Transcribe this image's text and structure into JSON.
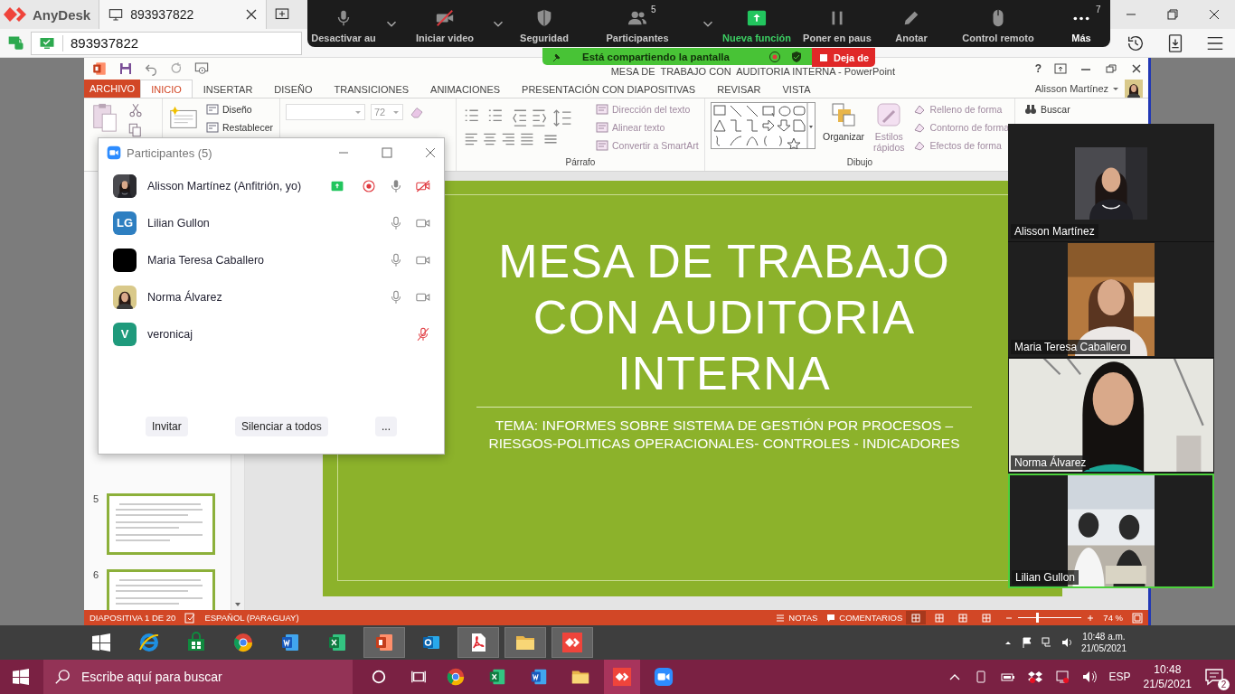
{
  "anydesk": {
    "app_name": "AnyDesk",
    "tab_label": "893937822",
    "address_value": "893937822"
  },
  "zoom_toolbar": {
    "items": [
      {
        "label": "Desactivar au",
        "kind": "normal",
        "has_menu": true
      },
      {
        "label": "Iniciar video",
        "kind": "normal",
        "has_menu": true
      },
      {
        "label": "Seguridad",
        "kind": "normal",
        "has_menu": false
      },
      {
        "label": "Participantes",
        "kind": "normal",
        "has_menu": true,
        "count": "5"
      },
      {
        "label": "Nueva función",
        "kind": "new",
        "has_menu": false
      },
      {
        "label": "Poner en paus",
        "kind": "normal",
        "has_menu": false
      },
      {
        "label": "Anotar",
        "kind": "normal",
        "has_menu": false
      },
      {
        "label": "Control remoto",
        "kind": "normal",
        "has_menu": false
      },
      {
        "label": "Más",
        "kind": "more",
        "has_menu": false,
        "count": "7"
      }
    ]
  },
  "sharing_bar": {
    "message": "Está compartiendo la pantalla",
    "stop_label": "Deja de"
  },
  "powerpoint": {
    "title": "MESA DE  TRABAJO CON  AUDITORIA INTERNA - PowerPoint",
    "help_label": "?",
    "file_tab": "ARCHIVO",
    "tabs": [
      {
        "label": "INICIO",
        "selected": true
      },
      {
        "label": "INSERTAR",
        "selected": false
      },
      {
        "label": "DISEÑO",
        "selected": false
      },
      {
        "label": "TRANSICIONES",
        "selected": false
      },
      {
        "label": "ANIMACIONES",
        "selected": false
      },
      {
        "label": "PRESENTACIÓN CON DIAPOSITIVAS",
        "selected": false
      },
      {
        "label": "REVISAR",
        "selected": false
      },
      {
        "label": "VISTA",
        "selected": false
      }
    ],
    "user_name": "Alisson Martínez",
    "ribbon": {
      "slide_commands": [
        {
          "label": "Diseño",
          "disabled": false
        },
        {
          "label": "Restablecer",
          "disabled": false
        }
      ],
      "font_size": "72",
      "paragraph_commands": [
        {
          "label": "Dirección del texto",
          "disabled": true
        },
        {
          "label": "Alinear texto",
          "disabled": true
        },
        {
          "label": "Convertir a SmartArt",
          "disabled": true
        }
      ],
      "paragraph_label": "Párrafo",
      "arrange_label": "Organizar",
      "quick_styles": {
        "label": "Estilos rápidos",
        "disabled": true
      },
      "shape_commands": [
        {
          "label": "Relleno de forma",
          "disabled": true
        },
        {
          "label": "Contorno de forma",
          "disabled": true
        },
        {
          "label": "Efectos de forma",
          "disabled": true
        }
      ],
      "drawing_label": "Dibujo",
      "find_label": "Buscar"
    },
    "thumbnails": [
      {
        "number": "5"
      },
      {
        "number": "6"
      }
    ],
    "slide": {
      "title_lines": [
        "MESA DE TRABAJO",
        "CON AUDITORIA",
        "INTERNA"
      ],
      "subtitle_lines": [
        "TEMA: INFORMES SOBRE SISTEMA DE GESTIÓN POR PROCESOS –",
        "RIESGOS-POLITICAS OPERACIONALES- CONTROLES - INDICADORES"
      ]
    },
    "status_bar": {
      "slide_info": "DIAPOSITIVA 1 DE 20",
      "language": "ESPAÑOL (PARAGUAY)",
      "notes": "NOTAS",
      "comments": "COMENTARIOS",
      "views": [
        {
          "selected": true
        },
        {
          "selected": false
        },
        {
          "selected": false
        },
        {
          "selected": false
        }
      ],
      "zoom": {
        "level": 0.3
      },
      "zoom_label": "74 %"
    }
  },
  "participants_panel": {
    "title": "Participantes (5)",
    "participants": [
      {
        "name": "Alisson Martínez (Anfitrión, yo)",
        "sharing": true,
        "recording": true,
        "mic_muted": false,
        "has_camera": true,
        "camera_off": true
      },
      {
        "name": "Lilian Gullon",
        "kind": "initials",
        "initials": "LG",
        "color": "#2e7fc1",
        "sharing": false,
        "recording": false,
        "mic_muted": false,
        "has_camera": true,
        "camera_off": false
      },
      {
        "name": "Maria Teresa Caballero",
        "kind": "blank",
        "color": "#000000",
        "sharing": false,
        "recording": false,
        "mic_muted": false,
        "has_camera": true,
        "camera_off": false
      },
      {
        "name": "Norma Álvarez",
        "sharing": false,
        "recording": false,
        "mic_muted": false,
        "has_camera": true,
        "camera_off": false
      },
      {
        "name": "veronicaj",
        "kind": "initials",
        "initials": "V",
        "color": "#1f9a7c",
        "sharing": false,
        "recording": false,
        "mic_muted": true,
        "has_camera": false
      }
    ],
    "buttons": [
      "Invitar",
      "Silenciar a todos",
      "..."
    ]
  },
  "video_gallery": {
    "tiles": [
      {
        "name": "Alisson Martínez",
        "selected": false
      },
      {
        "name": "Maria Teresa Caballero",
        "selected": false
      },
      {
        "name": "Norma Álvarez",
        "selected": false
      },
      {
        "name": "Lilian Gullon",
        "selected": true
      }
    ]
  },
  "remote_taskbar": {
    "apps": [
      {
        "open": false
      },
      {
        "open": false
      },
      {
        "open": false
      },
      {
        "open": false
      },
      {
        "open": false
      },
      {
        "open": true
      },
      {
        "open": false
      },
      {
        "open": true
      },
      {
        "open": true
      },
      {
        "open": true
      }
    ],
    "time": "10:48 a.m.",
    "date": "21/05/2021"
  },
  "local_taskbar": {
    "search_placeholder": "Escribe aquí para buscar",
    "apps": [
      {
        "selected": false
      },
      {
        "selected": false
      },
      {
        "selected": false
      },
      {
        "selected": false
      },
      {
        "selected": true
      },
      {
        "selected": false
      }
    ],
    "language": "ESP",
    "time": "10:48",
    "date": "21/5/2021",
    "notifications": "2"
  }
}
